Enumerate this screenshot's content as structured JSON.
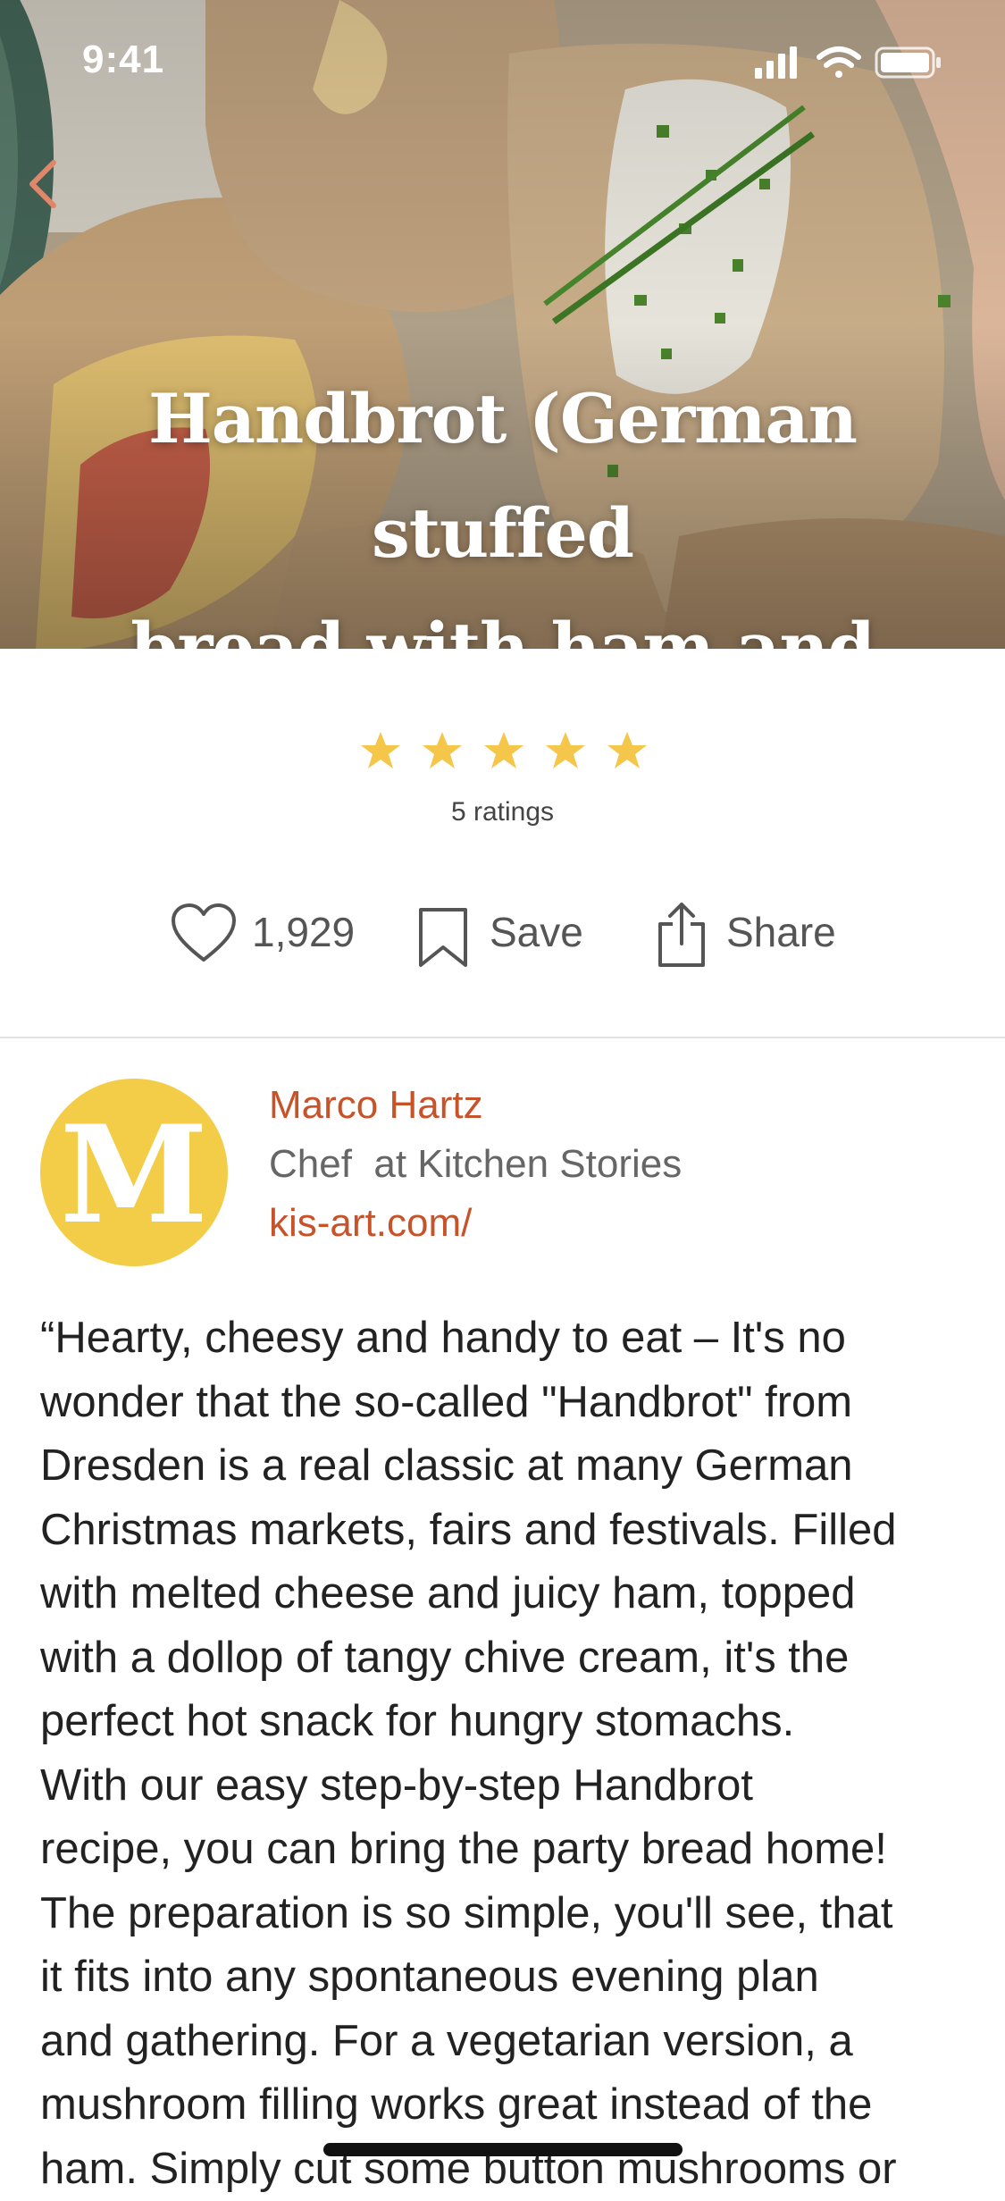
{
  "status_bar": {
    "time": "9:41"
  },
  "hero": {
    "title_line1": "Handbrot (German stuffed",
    "title_line2": "bread with ham and cheese)"
  },
  "rating": {
    "stars": 5,
    "max_stars": 5,
    "count_label": "5 ratings",
    "star_color": "#f4c64a"
  },
  "actions": {
    "likes": "1,929",
    "save_label": "Save",
    "share_label": "Share"
  },
  "author": {
    "initial": "M",
    "name": "Marco Hartz",
    "role": "Chef  at Kitchen Stories",
    "website": "kis-art.com/",
    "accent_color": "#c6532a",
    "avatar_color": "#f3cc48"
  },
  "description": "“Hearty, cheesy and handy to eat – It's no\nwonder that the so-called \"Handbrot\" from\nDresden is a real classic at many German\nChristmas markets, fairs and festivals. Filled\nwith melted cheese and juicy ham, topped\nwith a dollop of tangy chive cream, it's the\nperfect hot snack for hungry stomachs.\nWith our easy step-by-step Handbrot\nrecipe, you can bring the party bread home!\nThe preparation is so simple, you'll see, that\nit fits into any spontaneous evening plan\nand gathering. For a vegetarian version, a\nmushroom filling works great instead of the\nham. Simply cut some button mushrooms or"
}
